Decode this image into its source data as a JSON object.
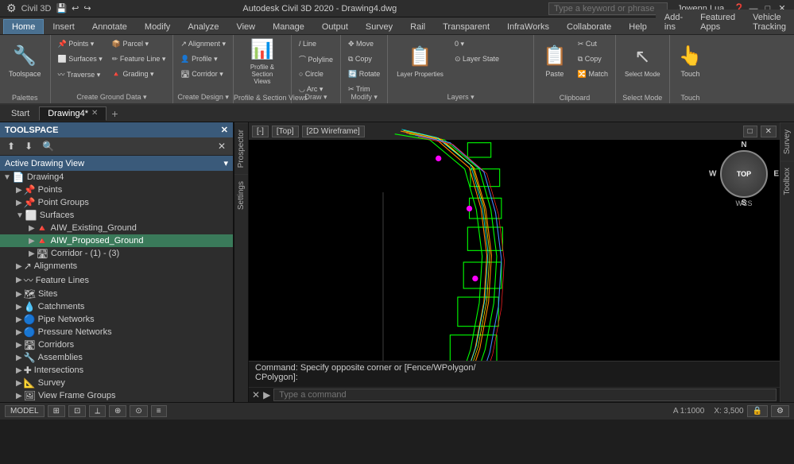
{
  "app": {
    "title": "Autodesk Civil 3D 2020 - Drawing4.dwg",
    "icon": "⚙",
    "search_placeholder": "Type a keyword or phrase",
    "user": "Jowenn.Lua",
    "window_controls": [
      "—",
      "□",
      "✕"
    ]
  },
  "ribbon_tabs": [
    {
      "label": "Home",
      "active": true
    },
    {
      "label": "Insert"
    },
    {
      "label": "Annotate"
    },
    {
      "label": "Modify"
    },
    {
      "label": "Analyze"
    },
    {
      "label": "View"
    },
    {
      "label": "Manage"
    },
    {
      "label": "Output"
    },
    {
      "label": "Survey"
    },
    {
      "label": "Rail"
    },
    {
      "label": "Transparent"
    },
    {
      "label": "InfraWorks"
    },
    {
      "label": "Collaborate"
    },
    {
      "label": "Help"
    },
    {
      "label": "Add-ins"
    },
    {
      "label": "Featured Apps"
    },
    {
      "label": "Vehicle Tracking"
    }
  ],
  "ribbon_groups": [
    {
      "name": "palettes",
      "label": "Palettes",
      "buttons": [
        {
          "icon": "🔧",
          "label": "Toolspace",
          "large": true
        }
      ]
    },
    {
      "name": "create-ground",
      "label": "Create Ground Data",
      "buttons": [
        {
          "icon": "📌",
          "label": "Points ▾"
        },
        {
          "icon": "⬜",
          "label": "Surfaces ▾"
        },
        {
          "icon": "〰",
          "label": "Traverse ▾"
        },
        {
          "icon": "📦",
          "label": "Parcel ▾"
        },
        {
          "icon": "✏",
          "label": "Feature Line ▾"
        },
        {
          "icon": "🔺",
          "label": "Grading ▾"
        }
      ]
    },
    {
      "name": "create-design",
      "label": "Create Design",
      "buttons": [
        {
          "icon": "↗",
          "label": "Alignment ▾"
        },
        {
          "icon": "👤",
          "label": "Profile ▾"
        },
        {
          "icon": "🛣",
          "label": "Corridor ▾"
        }
      ]
    },
    {
      "name": "profile-section",
      "label": "Profile & Section Views",
      "buttons": [
        {
          "icon": "📊",
          "label": "Profile & Section Views"
        }
      ]
    },
    {
      "name": "draw",
      "label": "Draw",
      "buttons": [
        {
          "icon": "✏",
          "label": "Draw ▾"
        }
      ]
    },
    {
      "name": "modify",
      "label": "Modify",
      "buttons": [
        {
          "icon": "🔄",
          "label": "Modify ▾"
        }
      ]
    },
    {
      "name": "layers",
      "label": "Layers",
      "buttons": [
        {
          "icon": "📋",
          "label": "Layer Properties",
          "large": true
        }
      ]
    },
    {
      "name": "clipboard",
      "label": "Clipboard",
      "buttons": [
        {
          "icon": "📋",
          "label": "Paste",
          "large": true
        }
      ]
    },
    {
      "name": "select-mode",
      "label": "Select Mode",
      "buttons": [
        {
          "icon": "↖",
          "label": "Select Mode",
          "large": true
        }
      ]
    },
    {
      "name": "touch",
      "label": "Touch",
      "buttons": [
        {
          "icon": "👆",
          "label": "Touch",
          "large": true
        }
      ]
    }
  ],
  "doc_tabs": [
    {
      "label": "Start",
      "closeable": false,
      "active": false
    },
    {
      "label": "Drawing4*",
      "closeable": true,
      "active": true
    }
  ],
  "toolspace": {
    "title": "TOOLSPACE",
    "view_label": "Active Drawing View",
    "toolbar_buttons": [
      "⬆",
      "⬇",
      "🔍",
      "✕"
    ],
    "tree": [
      {
        "label": "Drawing4",
        "level": 0,
        "expanded": true,
        "icon": "📄"
      },
      {
        "label": "Points",
        "level": 1,
        "expanded": false,
        "icon": "📌"
      },
      {
        "label": "Point Groups",
        "level": 1,
        "expanded": false,
        "icon": "📌"
      },
      {
        "label": "Surfaces",
        "level": 1,
        "expanded": true,
        "icon": "⬜"
      },
      {
        "label": "AIW_Existing_Ground",
        "level": 2,
        "expanded": false,
        "icon": "🔺",
        "selected": false
      },
      {
        "label": "AIW_Proposed_Ground",
        "level": 2,
        "expanded": false,
        "icon": "🔺",
        "selected": true
      },
      {
        "label": "Corridor - (1) - (3)",
        "level": 2,
        "expanded": false,
        "icon": "🛣"
      },
      {
        "label": "Alignments",
        "level": 1,
        "expanded": false,
        "icon": "↗"
      },
      {
        "label": "Feature Lines",
        "level": 1,
        "expanded": false,
        "icon": "〰"
      },
      {
        "label": "Sites",
        "level": 1,
        "expanded": false,
        "icon": "🗺"
      },
      {
        "label": "Catchments",
        "level": 1,
        "expanded": false,
        "icon": "💧"
      },
      {
        "label": "Pipe Networks",
        "level": 1,
        "expanded": false,
        "icon": "🔵"
      },
      {
        "label": "Pressure Networks",
        "level": 1,
        "expanded": false,
        "icon": "🔵"
      },
      {
        "label": "Corridors",
        "level": 1,
        "expanded": false,
        "icon": "🛣"
      },
      {
        "label": "Assemblies",
        "level": 1,
        "expanded": false,
        "icon": "🔧"
      },
      {
        "label": "Intersections",
        "level": 1,
        "expanded": false,
        "icon": "✚"
      },
      {
        "label": "Survey",
        "level": 1,
        "expanded": false,
        "icon": "📐"
      },
      {
        "label": "View Frame Groups",
        "level": 1,
        "expanded": false,
        "icon": "🖼"
      }
    ]
  },
  "side_tabs": [
    {
      "label": "Prospector"
    },
    {
      "label": "Settings"
    }
  ],
  "right_side_tabs": [
    {
      "label": "Survey"
    },
    {
      "label": "Toolbox"
    }
  ],
  "viewport": {
    "menu_items": [
      "[-]",
      "[Top]",
      "[2D Wireframe]"
    ],
    "compass": {
      "n": "N",
      "s": "S",
      "e": "E",
      "w": "W",
      "center": "TOP"
    },
    "label": "WCS",
    "coord_readout": "X: 3500"
  },
  "command_bar": {
    "output_line1": "Command: Specify opposite corner or [Fence/WPolygon/",
    "output_line2": "CPolygon]:",
    "input_placeholder": "Type a command"
  },
  "statusbar": {
    "model_btn": "MODEL",
    "grid_btn": "⊞",
    "snap_btn": "⊡",
    "coords": "1:1000",
    "right_items": [
      "⟨⟩",
      "⚙",
      "▣",
      "☰"
    ]
  }
}
